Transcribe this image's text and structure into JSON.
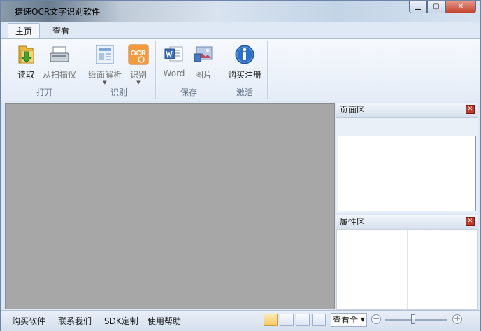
{
  "window": {
    "title": "捷速OCR文字识别软件",
    "minimize": "▁",
    "maximize": "▢",
    "close": "✕"
  },
  "tabs": [
    {
      "label": "主页"
    },
    {
      "label": "查看"
    }
  ],
  "ribbon": {
    "groups": [
      {
        "label": "打开",
        "buttons": [
          {
            "label": "读取",
            "icon": "folder-arrow-icon"
          },
          {
            "label": "从扫描仪",
            "icon": "scanner-icon"
          }
        ]
      },
      {
        "label": "识别",
        "buttons": [
          {
            "label": "纸面解析",
            "icon": "layout-analysis-icon"
          },
          {
            "label": "识别",
            "icon": "ocr-icon",
            "icon_text": "OCR"
          }
        ]
      },
      {
        "label": "保存",
        "buttons": [
          {
            "label": "Word",
            "icon": "word-doc-icon"
          },
          {
            "label": "图片",
            "icon": "picture-icon"
          }
        ]
      },
      {
        "label": "激活",
        "buttons": [
          {
            "label": "购买注册",
            "icon": "info-icon"
          }
        ]
      }
    ],
    "dropdown_arrow": "▼"
  },
  "panels": {
    "page": {
      "title": "页面区",
      "close": "✕"
    },
    "properties": {
      "title": "属性区",
      "close": "✕"
    }
  },
  "statusbar": {
    "links": [
      "购买软件",
      "联系我们",
      "SDK定制",
      "使用帮助"
    ],
    "zoom": "查看全",
    "zoom_dd": "▼",
    "zoom_out": "−",
    "zoom_in": "+",
    "zoom_level": 0.45
  },
  "colors": {
    "accent_blue": "#2a6fc9",
    "close_red": "#c0392b",
    "workspace_gray": "#a7a7a7"
  }
}
